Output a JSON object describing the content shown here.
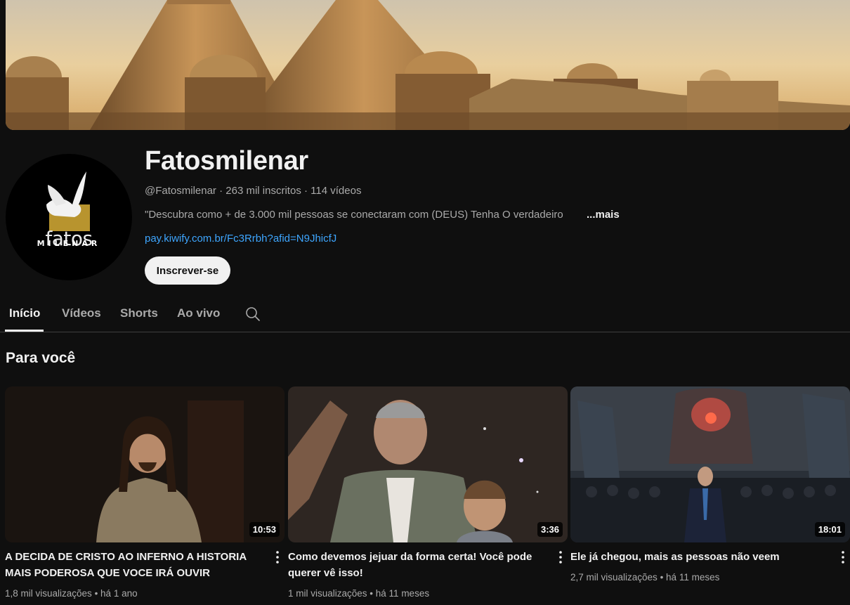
{
  "channel": {
    "name": "Fatosmilenar",
    "handle": "@Fatosmilenar",
    "subscribers": "263 mil inscritos",
    "videos_count": "114 vídeos",
    "separator": " · ",
    "description": "\"Descubra como + de 3.000 mil pessoas se conectaram com (DEUS) Tenha O verdadeiro",
    "more_label": "...mais",
    "link": "pay.kiwify.com.br/Fc3Rrbh?afid=N9JhicfJ",
    "subscribe_label": "Inscrever-se",
    "avatar_logo_word1": "fatos",
    "avatar_logo_word2": "MILENAR"
  },
  "tabs": [
    {
      "label": "Início",
      "active": true
    },
    {
      "label": "Vídeos",
      "active": false
    },
    {
      "label": "Shorts",
      "active": false
    },
    {
      "label": "Ao vivo",
      "active": false
    }
  ],
  "search_icon": "search-icon",
  "section": {
    "title": "Para você"
  },
  "videos": [
    {
      "title": "A DECIDA DE CRISTO AO INFERNO A HISTORIA MAIS PODEROSA QUE VOCE IRÁ OUVIR",
      "duration": "10:53",
      "views": "1,8 mil visualizações",
      "age": "há 1 ano"
    },
    {
      "title": "Como devemos jejuar da forma certa! Você pode querer vê isso!",
      "duration": "3:36",
      "views": "1 mil visualizações",
      "age": "há 11 meses"
    },
    {
      "title": "Ele já chegou, mais as pessoas não veem",
      "duration": "18:01",
      "views": "2,7 mil visualizações",
      "age": "há 11 meses"
    }
  ],
  "colors": {
    "background": "#0f0f0f",
    "text_primary": "#f1f1f1",
    "text_secondary": "#aaaaaa",
    "link": "#3ea6ff",
    "subscribe_bg": "#f1f1f1"
  }
}
